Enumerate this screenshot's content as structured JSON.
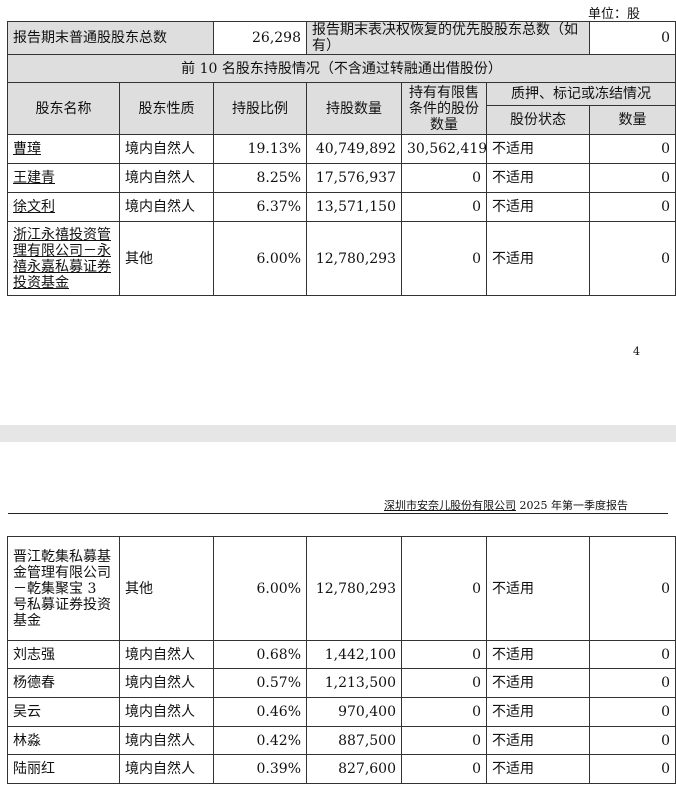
{
  "unit_label": "单位：股",
  "summary": {
    "common_label": "报告期末普通股股东总数",
    "common_value": "26,298",
    "preferred_label": "报告期末表决权恢复的优先股股东总数（如有）",
    "preferred_value": "0"
  },
  "section_title": "前 10 名股东持股情况（不含通过转融通出借股份）",
  "headers": {
    "name": "股东名称",
    "nature": "股东性质",
    "ratio": "持股比例",
    "count": "持股数量",
    "restricted": "持有有限售条件的股份数量",
    "pledge_group": "质押、标记或冻结情况",
    "pledge_status": "股份状态",
    "pledge_count": "数量"
  },
  "rows_page1": [
    {
      "name": "曹璋",
      "nature": "境内自然人",
      "ratio": "19.13%",
      "count": "40,749,892",
      "restricted": "30,562,419",
      "status": "不适用",
      "pledge": "0"
    },
    {
      "name": "王建青",
      "nature": "境内自然人",
      "ratio": "8.25%",
      "count": "17,576,937",
      "restricted": "0",
      "status": "不适用",
      "pledge": "0"
    },
    {
      "name": "徐文利",
      "nature": "境内自然人",
      "ratio": "6.37%",
      "count": "13,571,150",
      "restricted": "0",
      "status": "不适用",
      "pledge": "0"
    },
    {
      "name": "浙江永禧投资管理有限公司－永禧永嘉私募证券投资基金",
      "nature": "其他",
      "ratio": "6.00%",
      "count": "12,780,293",
      "restricted": "0",
      "status": "不适用",
      "pledge": "0"
    }
  ],
  "page_number": "4",
  "doc_header": {
    "company": "深圳市安奈儿股份有限公司",
    "title": " 2025 年第一季度报告"
  },
  "rows_page2": [
    {
      "name": "晋江乾集私募基金管理有限公司－乾集聚宝 3 号私募证券投资基金",
      "nature": "其他",
      "ratio": "6.00%",
      "count": "12,780,293",
      "restricted": "0",
      "status": "不适用",
      "pledge": "0"
    },
    {
      "name": "刘志强",
      "nature": "境内自然人",
      "ratio": "0.68%",
      "count": "1,442,100",
      "restricted": "0",
      "status": "不适用",
      "pledge": "0"
    },
    {
      "name": "杨德春",
      "nature": "境内自然人",
      "ratio": "0.57%",
      "count": "1,213,500",
      "restricted": "0",
      "status": "不适用",
      "pledge": "0"
    },
    {
      "name": "吴云",
      "nature": "境内自然人",
      "ratio": "0.46%",
      "count": "970,400",
      "restricted": "0",
      "status": "不适用",
      "pledge": "0"
    },
    {
      "name": "林淼",
      "nature": "境内自然人",
      "ratio": "0.42%",
      "count": "887,500",
      "restricted": "0",
      "status": "不适用",
      "pledge": "0"
    },
    {
      "name": "陆丽红",
      "nature": "境内自然人",
      "ratio": "0.39%",
      "count": "827,600",
      "restricted": "0",
      "status": "不适用",
      "pledge": "0"
    }
  ]
}
